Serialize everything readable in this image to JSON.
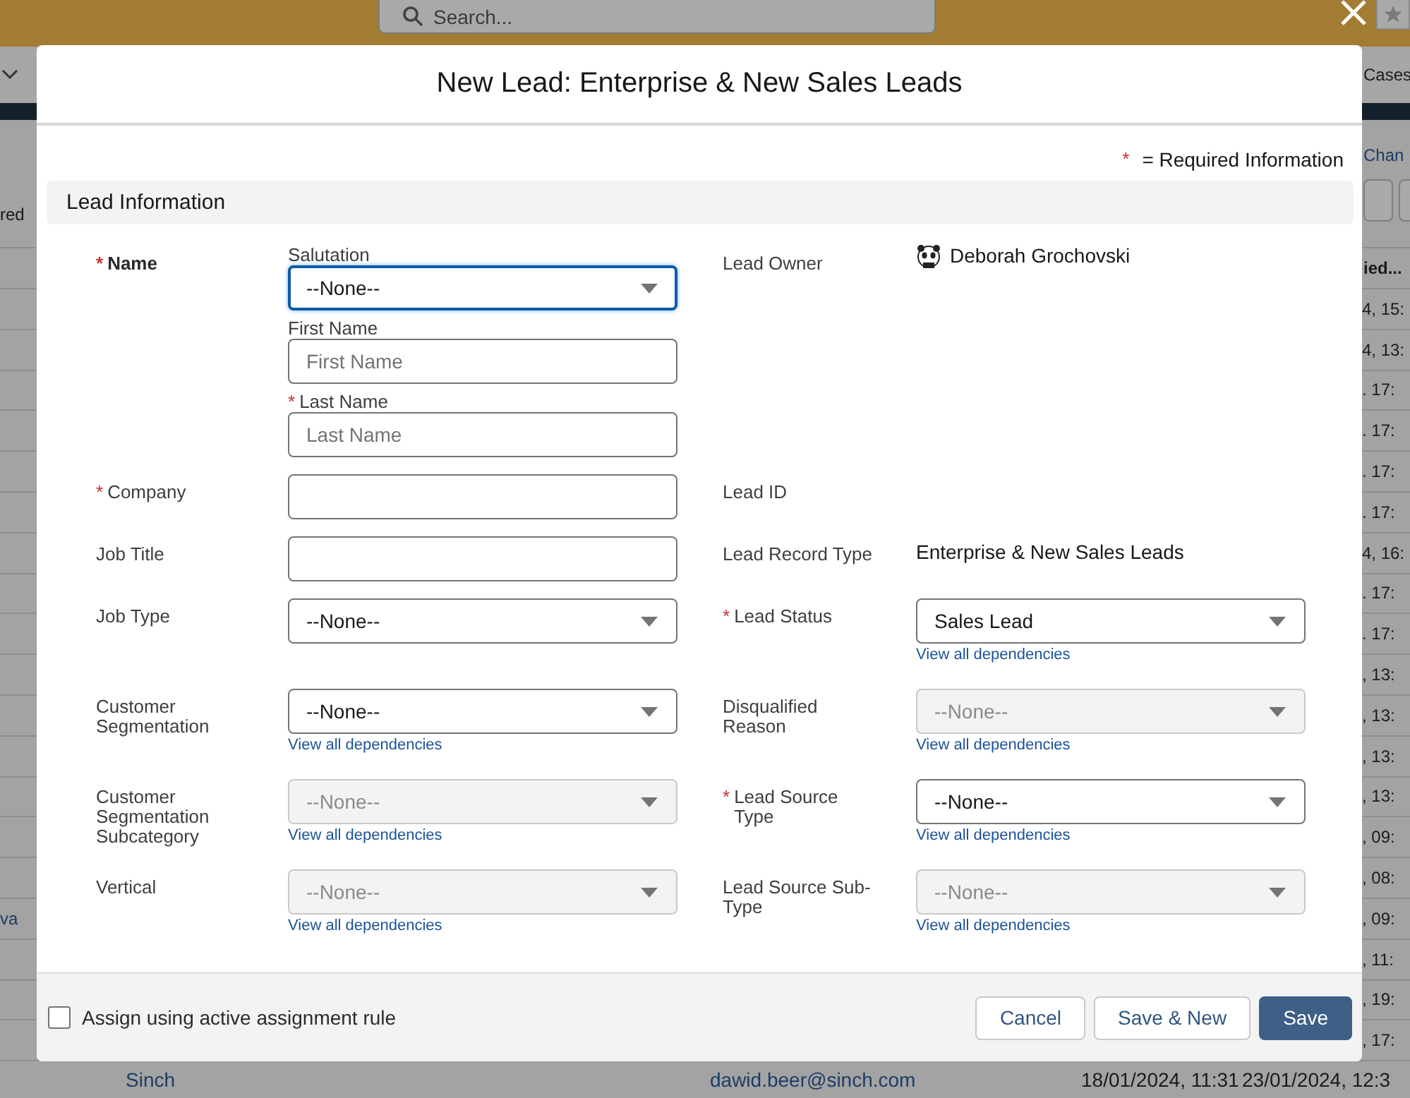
{
  "background": {
    "search": {
      "placeholder": "Search..."
    },
    "nav_tab": "Cases",
    "list_link": "Chan",
    "left_fragment": "red",
    "column_heading": "ied...",
    "rows": [
      {
        "right": "4, 15:"
      },
      {
        "right": "4, 13:"
      },
      {
        "right": ". 17:"
      },
      {
        "right": ". 17:"
      },
      {
        "right": ". 17:"
      },
      {
        "right": ". 17:"
      },
      {
        "right": "4, 16:"
      },
      {
        "right": ". 17:"
      },
      {
        "right": ". 17:"
      },
      {
        "right": ", 13:"
      },
      {
        "right": ", 13:"
      },
      {
        "right": ", 13:"
      },
      {
        "right": ", 13:"
      },
      {
        "right": ", 09:"
      },
      {
        "right": ", 08:"
      },
      {
        "left": "va",
        "right": ", 09:"
      },
      {
        "right": ", 11:"
      },
      {
        "right": ", 19:"
      },
      {
        "right": ", 17:"
      }
    ],
    "bottom_row": {
      "account": "Sinch",
      "email": "dawid.beer@sinch.com",
      "created": "18/01/2024, 11:31",
      "modified": "23/01/2024, 12:3"
    }
  },
  "modal": {
    "title": "New Lead: Enterprise & New Sales Leads",
    "required_mark": "*",
    "required_note": "= Required Information",
    "section": "Lead Information",
    "rows": [
      {
        "left": {
          "kind": "name",
          "label": "Name",
          "required": true,
          "parts": [
            {
              "kind": "select",
              "label": "Salutation",
              "required": false,
              "value": "--None--",
              "disabled": false,
              "focused": true
            },
            {
              "kind": "text",
              "label": "First Name",
              "required": false,
              "placeholder": "First Name",
              "disabled": false,
              "focused": false
            },
            {
              "kind": "text",
              "label": "Last Name",
              "required": true,
              "placeholder": "Last Name",
              "disabled": false,
              "focused": false
            }
          ]
        },
        "right": {
          "kind": "owner",
          "label": "Lead Owner",
          "required": false,
          "value": "Deborah Grochovski"
        }
      },
      {
        "left": {
          "kind": "text",
          "label": "Company",
          "required": true,
          "disabled": false,
          "focused": false
        },
        "right": {
          "kind": "display",
          "label": "Lead ID",
          "required": false
        }
      },
      {
        "left": {
          "kind": "text",
          "label": "Job Title",
          "required": false,
          "disabled": false,
          "focused": false
        },
        "right": {
          "kind": "display",
          "label": "Lead Record Type",
          "required": false,
          "value": "Enterprise & New Sales Leads"
        }
      },
      {
        "left": {
          "kind": "select",
          "label": "Job Type",
          "required": false,
          "value": "--None--",
          "disabled": false,
          "focused": false
        },
        "right": {
          "kind": "select",
          "label": "Lead Status",
          "required": true,
          "value": "Sales Lead",
          "disabled": false,
          "focused": false,
          "link": "View all dependencies"
        }
      },
      {
        "left": {
          "kind": "select",
          "label": "Customer Segmentation",
          "required": false,
          "value": "--None--",
          "disabled": false,
          "focused": false,
          "link": "View all dependencies"
        },
        "right": {
          "kind": "select",
          "label": "Disqualified Reason",
          "required": false,
          "value": "--None--",
          "disabled": true,
          "focused": false,
          "link": "View all dependencies"
        }
      },
      {
        "left": {
          "kind": "select",
          "label": "Customer Segmentation Subcategory",
          "required": false,
          "value": "--None--",
          "disabled": true,
          "focused": false,
          "link": "View all dependencies"
        },
        "right": {
          "kind": "select",
          "label": "Lead Source Type",
          "required": true,
          "value": "--None--",
          "disabled": false,
          "focused": false,
          "link": "View all dependencies"
        }
      },
      {
        "left": {
          "kind": "select",
          "label": "Vertical",
          "required": false,
          "value": "--None--",
          "disabled": true,
          "focused": false,
          "link": "View all dependencies"
        },
        "right": {
          "kind": "select",
          "label": "Lead Source Sub-Type",
          "required": false,
          "value": "--None--",
          "disabled": true,
          "focused": false,
          "link": "View all dependencies"
        }
      }
    ],
    "footer": {
      "checkbox": {
        "label": "Assign using active assignment rule",
        "checked": false
      },
      "buttons": [
        {
          "label": "Cancel",
          "kind": "neutral"
        },
        {
          "label": "Save & New",
          "kind": "neutral"
        },
        {
          "label": "Save",
          "kind": "brand"
        }
      ]
    }
  }
}
